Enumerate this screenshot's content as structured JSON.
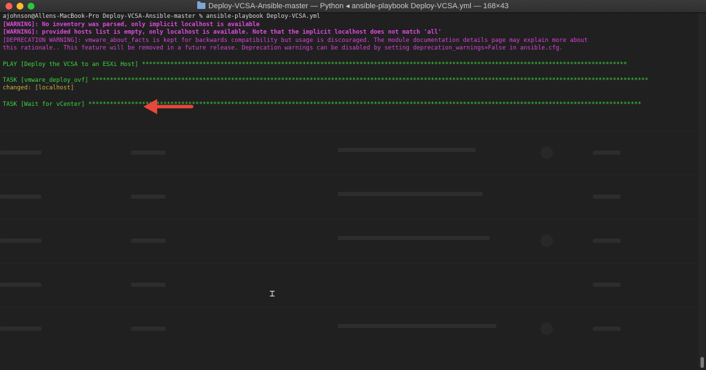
{
  "window": {
    "title": "Deploy-VCSA-Ansible-master — Python ◂ ansible-playbook Deploy-VCSA.yml — 168×43"
  },
  "terminal": {
    "lines": [
      {
        "text": "ajohnson@Allens-MacBook-Pro Deploy-VCSA-Ansible-master % ansible-playbook Deploy-VCSA.yml",
        "style": "white"
      },
      {
        "text": "[WARNING]: No inventory was parsed, only implicit localhost is available",
        "style": "magenta-b"
      },
      {
        "text": "[WARNING]: provided hosts list is empty, only localhost is available. Note that the implicit localhost does not match 'all'",
        "style": "magenta-b"
      },
      {
        "text": "[DEPRECATION WARNING]: vmware_about_facts is kept for backwards compatibility but usage is discouraged. The module documentation details page may explain more about",
        "style": "magenta"
      },
      {
        "text": "this rationale.. This feature will be removed in a future release. Deprecation warnings can be disabled by setting deprecation_warnings=False in ansible.cfg.",
        "style": "magenta"
      },
      {
        "text": "",
        "style": "white"
      },
      {
        "text": "PLAY [Deploy the VCSA to an ESXi Host] ****************************************************************************************************************************************",
        "style": "green"
      },
      {
        "text": "",
        "style": "white"
      },
      {
        "text": "TASK [vmware_deploy_ovf] ************************************************************************************************************************************************************",
        "style": "green"
      },
      {
        "text": "changed: [localhost]",
        "style": "yellow"
      },
      {
        "text": "",
        "style": "white"
      },
      {
        "text": "TASK [Wait for vCenter] ***********************************************************************************************************************************************************",
        "style": "green"
      }
    ]
  },
  "colors": {
    "annotation_arrow": "#e8473b"
  }
}
